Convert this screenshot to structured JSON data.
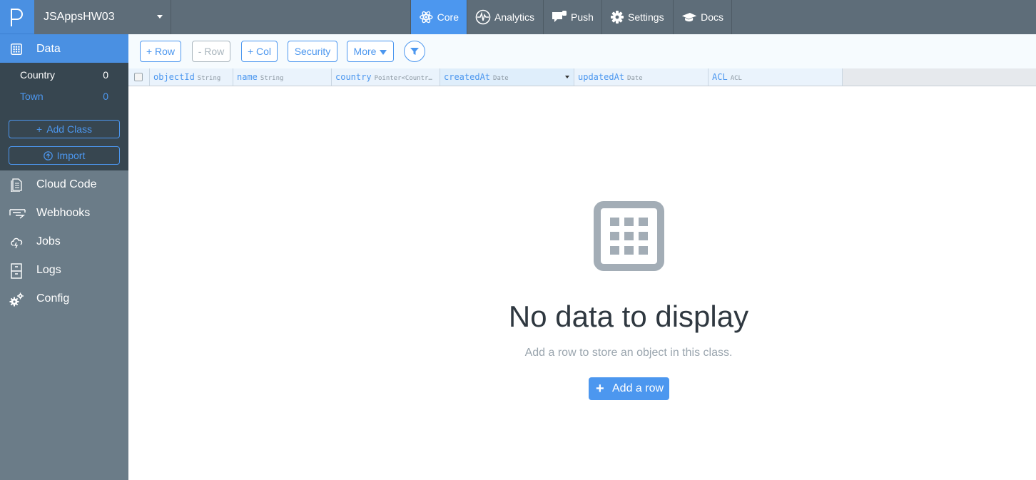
{
  "app": {
    "name": "JSAppsHW03"
  },
  "topnav": [
    {
      "label": "Core",
      "icon": "atom-icon",
      "active": true
    },
    {
      "label": "Analytics",
      "icon": "pulse-icon"
    },
    {
      "label": "Push",
      "icon": "chat-bubble-icon"
    },
    {
      "label": "Settings",
      "icon": "gear-icon"
    },
    {
      "label": "Docs",
      "icon": "graduation-cap-icon"
    }
  ],
  "sidebar": {
    "data_label": "Data",
    "classes": [
      {
        "name": "Country",
        "count": "0"
      },
      {
        "name": "Town",
        "count": "0"
      }
    ],
    "add_class_label": "Add Class",
    "import_label": "Import",
    "items": [
      {
        "label": "Cloud Code",
        "icon": "document-icon"
      },
      {
        "label": "Webhooks",
        "icon": "webhook-icon"
      },
      {
        "label": "Jobs",
        "icon": "cloud-icon"
      },
      {
        "label": "Logs",
        "icon": "file-cabinet-icon"
      },
      {
        "label": "Config",
        "icon": "gears-icon"
      }
    ]
  },
  "toolbar": {
    "add_row": "+ Row",
    "delete_row": "- Row",
    "add_col": "+ Col",
    "security": "Security",
    "more": "More"
  },
  "columns": [
    {
      "name": "objectId",
      "type": "String"
    },
    {
      "name": "name",
      "type": "String"
    },
    {
      "name": "country",
      "type": "Pointer<Countr…"
    },
    {
      "name": "createdAt",
      "type": "Date",
      "sorted": true
    },
    {
      "name": "updatedAt",
      "type": "Date"
    },
    {
      "name": "ACL",
      "type": "ACL"
    }
  ],
  "empty_state": {
    "title": "No data to display",
    "subtitle": "Add a row to store an object in this class.",
    "button": "Add a row"
  },
  "colors": {
    "accent": "#4c97ef",
    "topbar": "#5e6d79",
    "sidebar": "#6b7c88",
    "sidebar_classes": "#374650"
  }
}
